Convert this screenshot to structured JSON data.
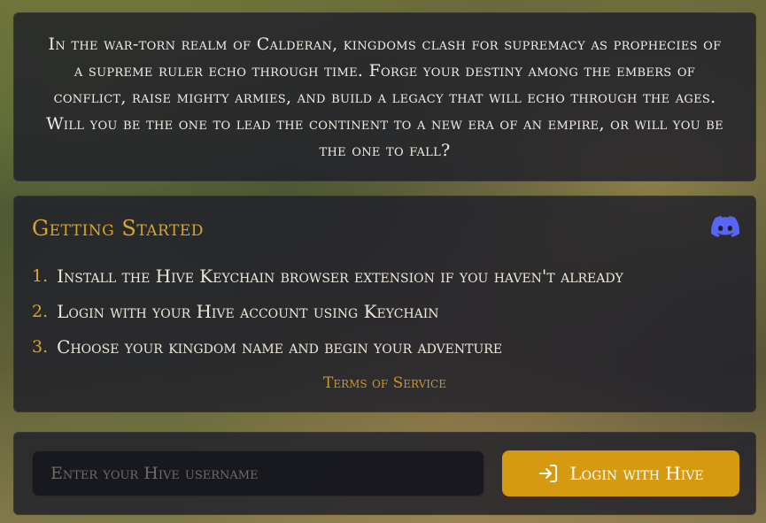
{
  "story": {
    "text": "In the war-torn realm of Calderan, kingdoms clash for supremacy as prophecies of a supreme ruler echo through time. Forge your destiny among the embers of conflict, raise mighty armies, and build a legacy that will echo through the ages. Will you be the one to lead the continent to a new era of an empire, or will you be the one to fall?"
  },
  "getting_started": {
    "title": "Getting Started",
    "discord_icon": "discord-icon",
    "discord_color": "#5865F2",
    "steps": [
      {
        "number": "1.",
        "text": "Install the Hive Keychain browser extension if you haven't already"
      },
      {
        "number": "2.",
        "text": "Login with your Hive account using Keychain"
      },
      {
        "number": "3.",
        "text": "Choose your kingdom name and begin your adventure"
      }
    ],
    "terms_link": "Terms of Service"
  },
  "login": {
    "username_placeholder": "Enter your Hive username",
    "username_value": "",
    "button_label": "Login with Hive",
    "button_icon": "login-icon",
    "accent_color": "#D69A10"
  }
}
